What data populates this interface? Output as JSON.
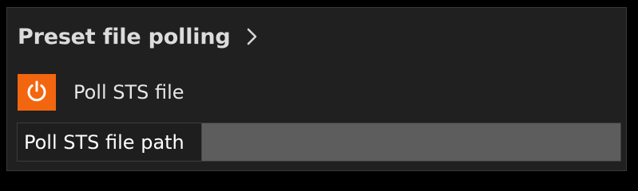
{
  "section": {
    "title": "Preset file polling",
    "chevron_icon": "chevron-right-icon"
  },
  "toggle": {
    "icon": "power-icon",
    "label": "Poll STS file",
    "accent_color": "#f2660f"
  },
  "field": {
    "label": "Poll STS file path",
    "value": ""
  }
}
